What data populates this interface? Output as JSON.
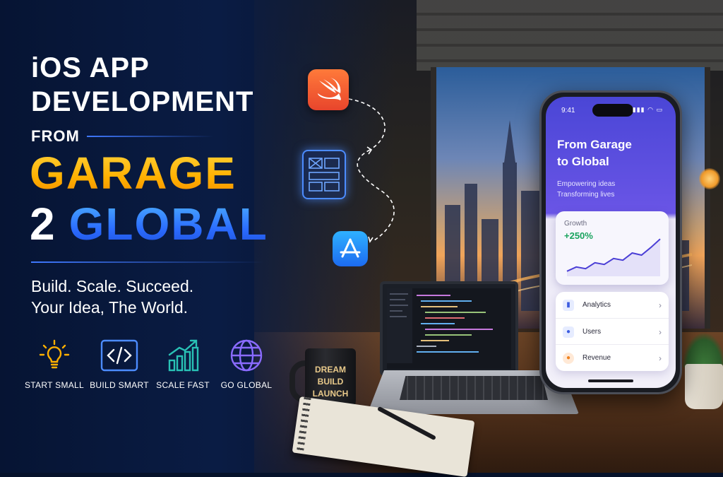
{
  "headline": {
    "line1": "iOS APP",
    "line2": "DEVELOPMENT",
    "from": "FROM",
    "garage": "GARAGE",
    "number": "2",
    "global": "GLOBAL"
  },
  "tagline": {
    "line1": "Build. Scale. Succeed.",
    "line2": "Your Idea, The World."
  },
  "features": [
    {
      "label": "START SMALL",
      "icon": "lightbulb-icon"
    },
    {
      "label": "BUILD SMART",
      "icon": "code-brackets-icon"
    },
    {
      "label": "SCALE FAST",
      "icon": "growth-bars-icon"
    },
    {
      "label": "GO GLOBAL",
      "icon": "globe-icon"
    }
  ],
  "workflow_icons": [
    "swift-logo-icon",
    "wireframe-icon",
    "app-store-icon"
  ],
  "mug": {
    "line1": "DREAM",
    "line2": "BUILD",
    "line3": "LAUNCH"
  },
  "phone": {
    "time": "9:41",
    "title_line1": "From Garage",
    "title_line2": "to Global",
    "subtitle_line1": "Empowering ideas",
    "subtitle_line2": "Transforming lives",
    "growth_label": "Growth",
    "growth_value": "+250%",
    "growth_trend": [
      0.12,
      0.22,
      0.18,
      0.32,
      0.28,
      0.42,
      0.38,
      0.55,
      0.5,
      0.68,
      0.88
    ],
    "menu": [
      {
        "label": "Analytics",
        "icon": "bar-chart-icon"
      },
      {
        "label": "Users",
        "icon": "users-icon"
      },
      {
        "label": "Revenue",
        "icon": "revenue-icon"
      }
    ]
  },
  "colors": {
    "navy": "#06122b",
    "gold": "#ffb000",
    "blue": "#2b6cff",
    "phone_purple": "#5a4ee0",
    "growth_green": "#18a35d"
  }
}
